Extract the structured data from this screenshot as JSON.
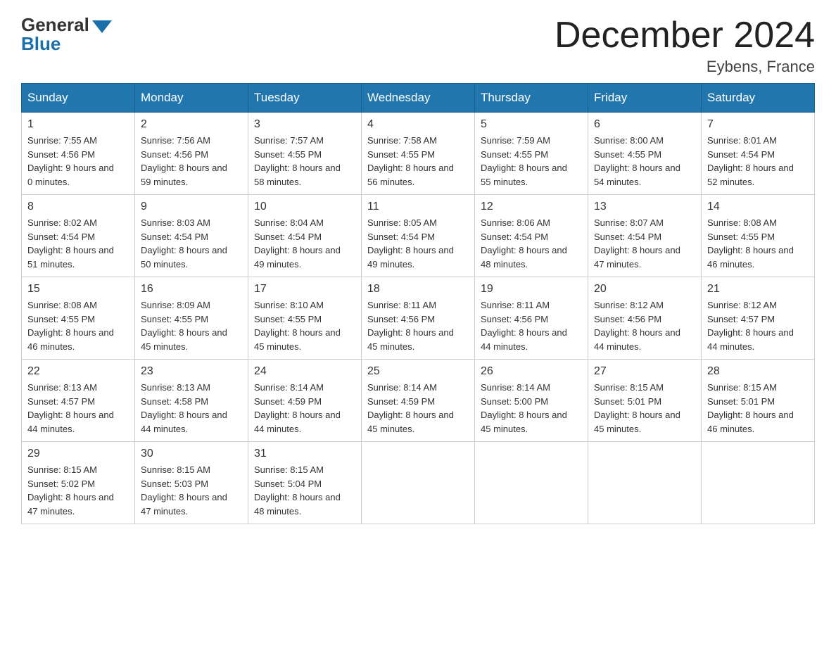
{
  "header": {
    "logo_general": "General",
    "logo_blue": "Blue",
    "month_title": "December 2024",
    "location": "Eybens, France"
  },
  "weekdays": [
    "Sunday",
    "Monday",
    "Tuesday",
    "Wednesday",
    "Thursday",
    "Friday",
    "Saturday"
  ],
  "weeks": [
    [
      {
        "day": "1",
        "sunrise": "7:55 AM",
        "sunset": "4:56 PM",
        "daylight": "9 hours and 0 minutes."
      },
      {
        "day": "2",
        "sunrise": "7:56 AM",
        "sunset": "4:56 PM",
        "daylight": "8 hours and 59 minutes."
      },
      {
        "day": "3",
        "sunrise": "7:57 AM",
        "sunset": "4:55 PM",
        "daylight": "8 hours and 58 minutes."
      },
      {
        "day": "4",
        "sunrise": "7:58 AM",
        "sunset": "4:55 PM",
        "daylight": "8 hours and 56 minutes."
      },
      {
        "day": "5",
        "sunrise": "7:59 AM",
        "sunset": "4:55 PM",
        "daylight": "8 hours and 55 minutes."
      },
      {
        "day": "6",
        "sunrise": "8:00 AM",
        "sunset": "4:55 PM",
        "daylight": "8 hours and 54 minutes."
      },
      {
        "day": "7",
        "sunrise": "8:01 AM",
        "sunset": "4:54 PM",
        "daylight": "8 hours and 52 minutes."
      }
    ],
    [
      {
        "day": "8",
        "sunrise": "8:02 AM",
        "sunset": "4:54 PM",
        "daylight": "8 hours and 51 minutes."
      },
      {
        "day": "9",
        "sunrise": "8:03 AM",
        "sunset": "4:54 PM",
        "daylight": "8 hours and 50 minutes."
      },
      {
        "day": "10",
        "sunrise": "8:04 AM",
        "sunset": "4:54 PM",
        "daylight": "8 hours and 49 minutes."
      },
      {
        "day": "11",
        "sunrise": "8:05 AM",
        "sunset": "4:54 PM",
        "daylight": "8 hours and 49 minutes."
      },
      {
        "day": "12",
        "sunrise": "8:06 AM",
        "sunset": "4:54 PM",
        "daylight": "8 hours and 48 minutes."
      },
      {
        "day": "13",
        "sunrise": "8:07 AM",
        "sunset": "4:54 PM",
        "daylight": "8 hours and 47 minutes."
      },
      {
        "day": "14",
        "sunrise": "8:08 AM",
        "sunset": "4:55 PM",
        "daylight": "8 hours and 46 minutes."
      }
    ],
    [
      {
        "day": "15",
        "sunrise": "8:08 AM",
        "sunset": "4:55 PM",
        "daylight": "8 hours and 46 minutes."
      },
      {
        "day": "16",
        "sunrise": "8:09 AM",
        "sunset": "4:55 PM",
        "daylight": "8 hours and 45 minutes."
      },
      {
        "day": "17",
        "sunrise": "8:10 AM",
        "sunset": "4:55 PM",
        "daylight": "8 hours and 45 minutes."
      },
      {
        "day": "18",
        "sunrise": "8:11 AM",
        "sunset": "4:56 PM",
        "daylight": "8 hours and 45 minutes."
      },
      {
        "day": "19",
        "sunrise": "8:11 AM",
        "sunset": "4:56 PM",
        "daylight": "8 hours and 44 minutes."
      },
      {
        "day": "20",
        "sunrise": "8:12 AM",
        "sunset": "4:56 PM",
        "daylight": "8 hours and 44 minutes."
      },
      {
        "day": "21",
        "sunrise": "8:12 AM",
        "sunset": "4:57 PM",
        "daylight": "8 hours and 44 minutes."
      }
    ],
    [
      {
        "day": "22",
        "sunrise": "8:13 AM",
        "sunset": "4:57 PM",
        "daylight": "8 hours and 44 minutes."
      },
      {
        "day": "23",
        "sunrise": "8:13 AM",
        "sunset": "4:58 PM",
        "daylight": "8 hours and 44 minutes."
      },
      {
        "day": "24",
        "sunrise": "8:14 AM",
        "sunset": "4:59 PM",
        "daylight": "8 hours and 44 minutes."
      },
      {
        "day": "25",
        "sunrise": "8:14 AM",
        "sunset": "4:59 PM",
        "daylight": "8 hours and 45 minutes."
      },
      {
        "day": "26",
        "sunrise": "8:14 AM",
        "sunset": "5:00 PM",
        "daylight": "8 hours and 45 minutes."
      },
      {
        "day": "27",
        "sunrise": "8:15 AM",
        "sunset": "5:01 PM",
        "daylight": "8 hours and 45 minutes."
      },
      {
        "day": "28",
        "sunrise": "8:15 AM",
        "sunset": "5:01 PM",
        "daylight": "8 hours and 46 minutes."
      }
    ],
    [
      {
        "day": "29",
        "sunrise": "8:15 AM",
        "sunset": "5:02 PM",
        "daylight": "8 hours and 47 minutes."
      },
      {
        "day": "30",
        "sunrise": "8:15 AM",
        "sunset": "5:03 PM",
        "daylight": "8 hours and 47 minutes."
      },
      {
        "day": "31",
        "sunrise": "8:15 AM",
        "sunset": "5:04 PM",
        "daylight": "8 hours and 48 minutes."
      },
      null,
      null,
      null,
      null
    ]
  ]
}
